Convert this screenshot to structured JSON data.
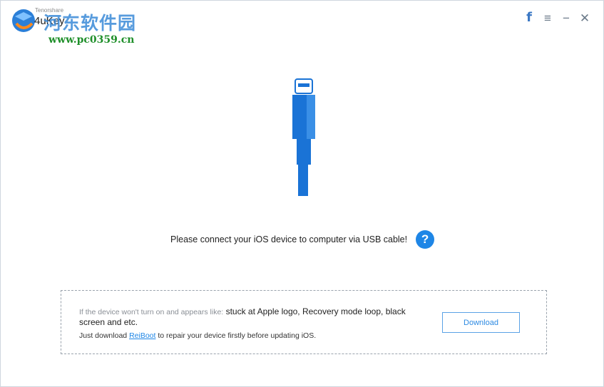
{
  "app": {
    "brand_small": "Tenorshare",
    "title": "4uKey"
  },
  "watermark": {
    "cn": "河东软件园",
    "url": "www.pc0359.cn"
  },
  "window_controls": {
    "facebook": "f",
    "menu": "≡",
    "minimize": "−",
    "close": "✕"
  },
  "main": {
    "prompt": "Please connect your iOS device to computer via USB cable!",
    "help": "?"
  },
  "info": {
    "muted_prefix": "If the device won't turn on and appears like:",
    "issue_text": "stuck at Apple logo, Recovery mode loop, black screen and etc.",
    "line2_prefix": "Just download",
    "link": "ReiBoot",
    "line2_suffix": "to repair your device firstly before updating iOS.",
    "download_label": "Download"
  },
  "colors": {
    "accent": "#1e86e6",
    "cable": "#1a73d6"
  },
  "icons": {
    "brand": "tenorshare-logo-icon",
    "cable": "lightning-cable-icon",
    "help": "question-circle-icon"
  }
}
